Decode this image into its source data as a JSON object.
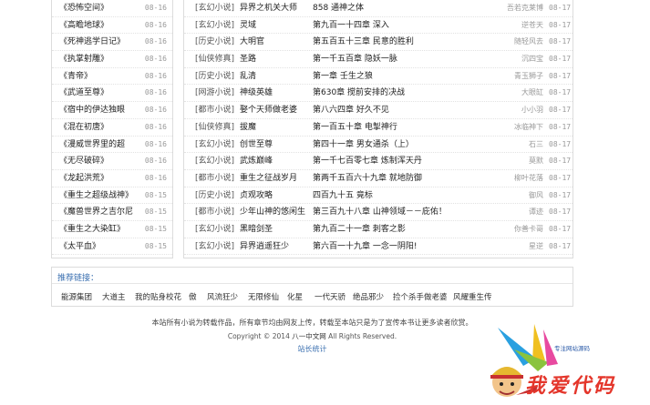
{
  "left_list": [
    {
      "title": "《恐怖空间》",
      "date": "08-16"
    },
    {
      "title": "《高瞻地球》",
      "date": "08-16"
    },
    {
      "title": "《死神逃学日记》",
      "date": "08-16"
    },
    {
      "title": "《执掌射雕》",
      "date": "08-16"
    },
    {
      "title": "《青帝》",
      "date": "08-16"
    },
    {
      "title": "《武道至尊》",
      "date": "08-16"
    },
    {
      "title": "《宿中的伊达独眼",
      "date": "08-16"
    },
    {
      "title": "《混在初唐》",
      "date": "08-16"
    },
    {
      "title": "《漫威世界里的超",
      "date": "08-16"
    },
    {
      "title": "《无尽破碎》",
      "date": "08-16"
    },
    {
      "title": "《龙起洪荒》",
      "date": "08-16"
    },
    {
      "title": "《重生之超级战神》",
      "date": "08-15"
    },
    {
      "title": "《魔兽世界之吉尔尼",
      "date": "08-15"
    },
    {
      "title": "《重生之大染缸》",
      "date": "08-15"
    },
    {
      "title": "《太平血》",
      "date": "08-15"
    }
  ],
  "right_list": [
    {
      "category": "[玄幻小说]",
      "book": "异界之机关大师",
      "chapter": "858 通神之体",
      "author": "吾若克莱博",
      "date": "08-17"
    },
    {
      "category": "[玄幻小说]",
      "book": "灵域",
      "chapter": "第九百一十四章 深入",
      "author": "逆苍天",
      "date": "08-17"
    },
    {
      "category": "[历史小说]",
      "book": "大明官",
      "chapter": "第五百五十三章 民意的胜利",
      "author": "随轻风去",
      "date": "08-17"
    },
    {
      "category": "[仙侠修真]",
      "book": "圣路",
      "chapter": "第一千五百章 隐妖一脉",
      "author": "沉四宝",
      "date": "08-17"
    },
    {
      "category": "[历史小说]",
      "book": "乱清",
      "chapter": "第一章 壬生之狼",
      "author": "青玉狮子",
      "date": "08-17"
    },
    {
      "category": "[网游小说]",
      "book": "神级英雄",
      "chapter": "第630章 搅前安排的决战",
      "author": "大眼缸",
      "date": "08-17"
    },
    {
      "category": "[都市小说]",
      "book": "娶个天师做老婆",
      "chapter": "第八六四章 好久不见",
      "author": "小小羽",
      "date": "08-17"
    },
    {
      "category": "[仙侠修真]",
      "book": "拔魔",
      "chapter": "第一百五十章 电掣神行",
      "author": "冰临神下",
      "date": "08-17"
    },
    {
      "category": "[玄幻小说]",
      "book": "创世至尊",
      "chapter": "第四十一章 男女通杀（上）",
      "author": "石三",
      "date": "08-17"
    },
    {
      "category": "[玄幻小说]",
      "book": "武炼巅峰",
      "chapter": "第一千七百零七章 炼制浑天丹",
      "author": "莫默",
      "date": "08-17"
    },
    {
      "category": "[都市小说]",
      "book": "重生之征战岁月",
      "chapter": "第两千五百六十九章 就地防御",
      "author": "柳叶花落",
      "date": "08-17"
    },
    {
      "category": "[历史小说]",
      "book": "贞观攻略",
      "chapter": "四百九十五 竟标",
      "author": "御风",
      "date": "08-17"
    },
    {
      "category": "[都市小说]",
      "book": "少年山神的悠闲生",
      "chapter": "第三百九十八章 山神领域－－庇佑！",
      "author": "谭迹",
      "date": "08-17"
    },
    {
      "category": "[玄幻小说]",
      "book": "黑暗剑圣",
      "chapter": "第九百二十一章 刺客之影",
      "author": "你善卡哥",
      "date": "08-17"
    },
    {
      "category": "[玄幻小说]",
      "book": "异界逍遥狂少",
      "chapter": "第六百一十九章 一念一阴阳!",
      "author": "星逆",
      "date": "08-17"
    }
  ],
  "links": {
    "title": "推荐链接：",
    "items": [
      "能源集团",
      "大道主",
      "我的贴身校花",
      "傲",
      "风流狂少",
      "无限修仙",
      "化星",
      "一代天骄",
      "绝品邪少",
      "捡个杀手做老婆",
      "风耀重生传"
    ]
  },
  "footer": {
    "notice": "本站所有小说为转载作品，所有章节均由网友上传，转载至本站只是为了宣传本书让更多读者欣赏。",
    "copyright_pre": "Copyright © 2014 ",
    "site_name": "八一中文网",
    "copyright_post": " All Rights Reserved.",
    "stats": "站长统计"
  },
  "watermark": {
    "tagline": "专注网站源码",
    "text": "我爱代码"
  }
}
